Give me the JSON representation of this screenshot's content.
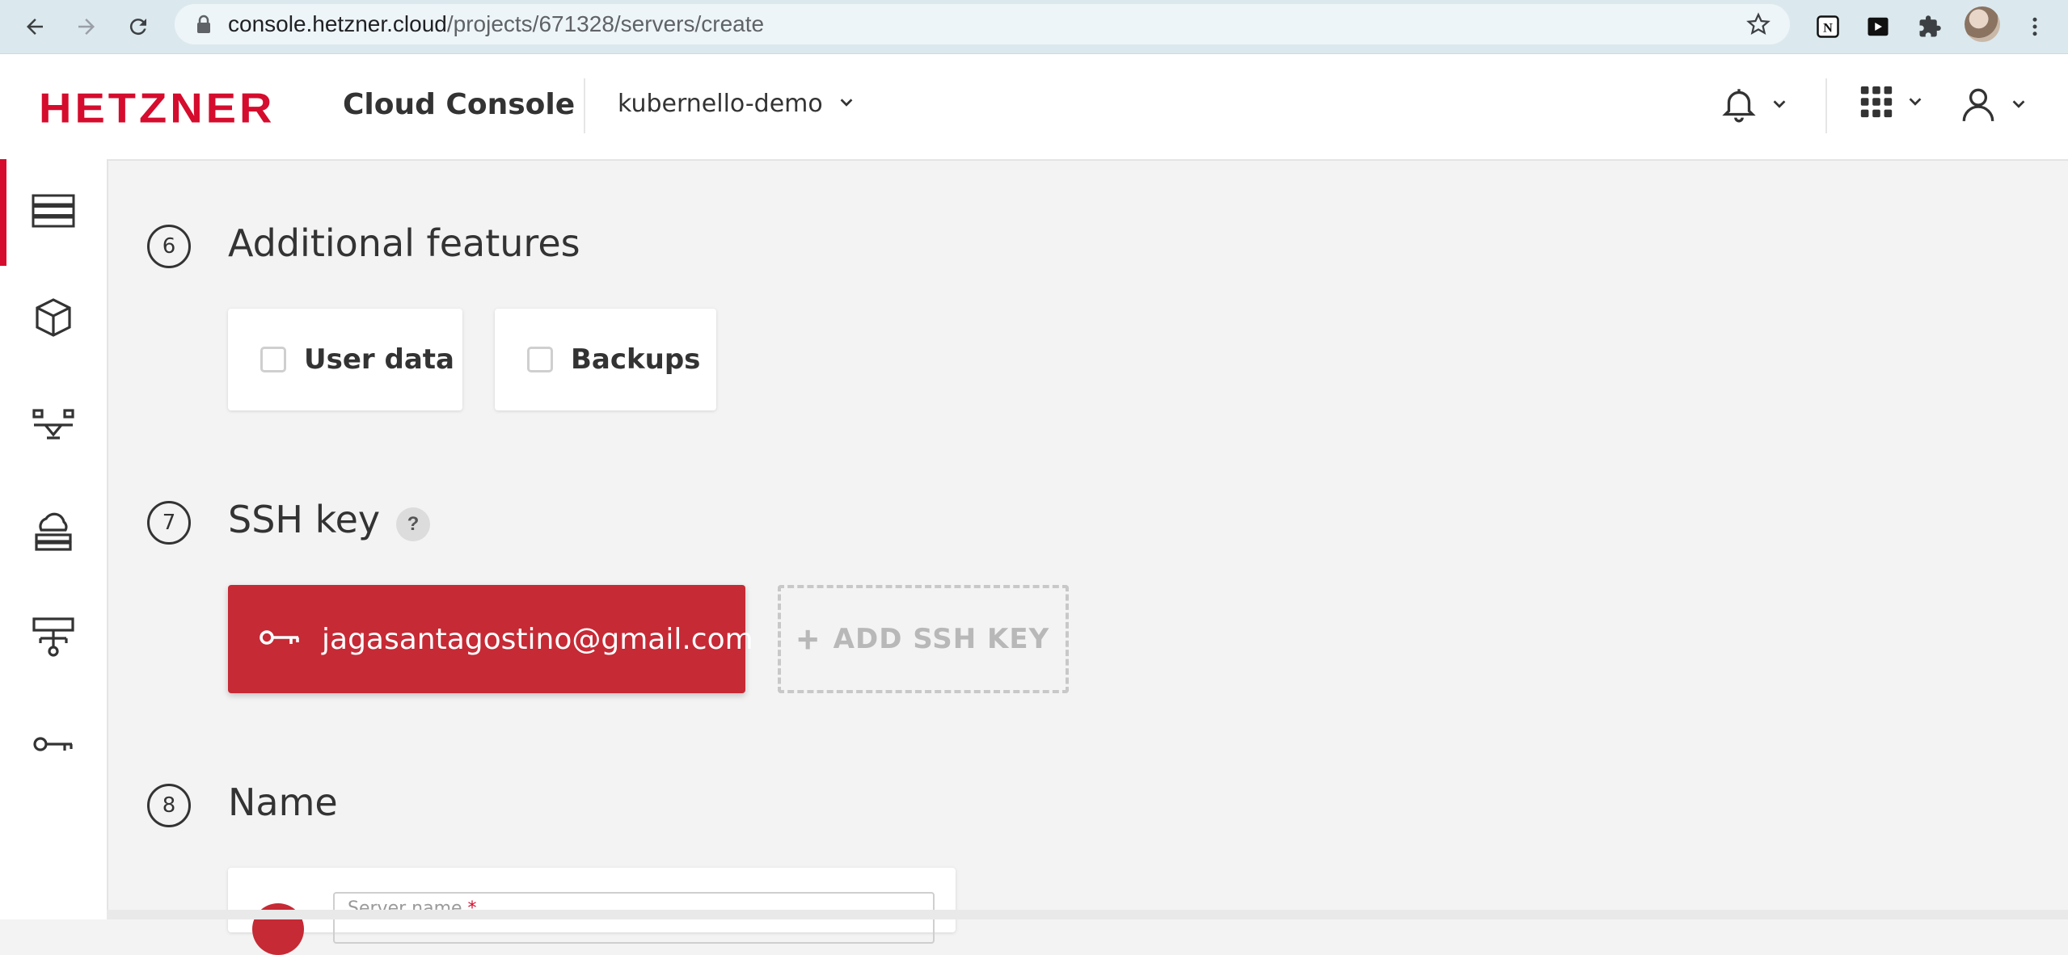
{
  "browser": {
    "url_host": "console.hetzner.cloud",
    "url_path": "/projects/671328/servers/create"
  },
  "header": {
    "logo": "HETZNER",
    "product": "Cloud Console",
    "project": "kubernello-demo"
  },
  "sidebar": {
    "items": [
      {
        "icon": "servers-icon",
        "active": true
      },
      {
        "icon": "volumes-icon",
        "active": false
      },
      {
        "icon": "load-balancers-icon",
        "active": false
      },
      {
        "icon": "floating-ips-icon",
        "active": false
      },
      {
        "icon": "networks-icon",
        "active": false
      },
      {
        "icon": "security-key-icon",
        "active": false
      }
    ]
  },
  "sections": {
    "features": {
      "number": "6",
      "title": "Additional features",
      "options": [
        {
          "label": "User data",
          "checked": false
        },
        {
          "label": "Backups",
          "checked": false
        }
      ]
    },
    "ssh": {
      "number": "7",
      "title": "SSH key",
      "help": "?",
      "key_label": "jagasantagostino@gmail.com",
      "add_label": "ADD SSH KEY",
      "add_symbol": "+"
    },
    "name": {
      "number": "8",
      "title": "Name",
      "placeholder": "Server name",
      "required_mark": "*"
    }
  },
  "colors": {
    "brand_red": "#d50c2d",
    "ssh_card": "#c62a35",
    "background": "#f3f3f3"
  }
}
